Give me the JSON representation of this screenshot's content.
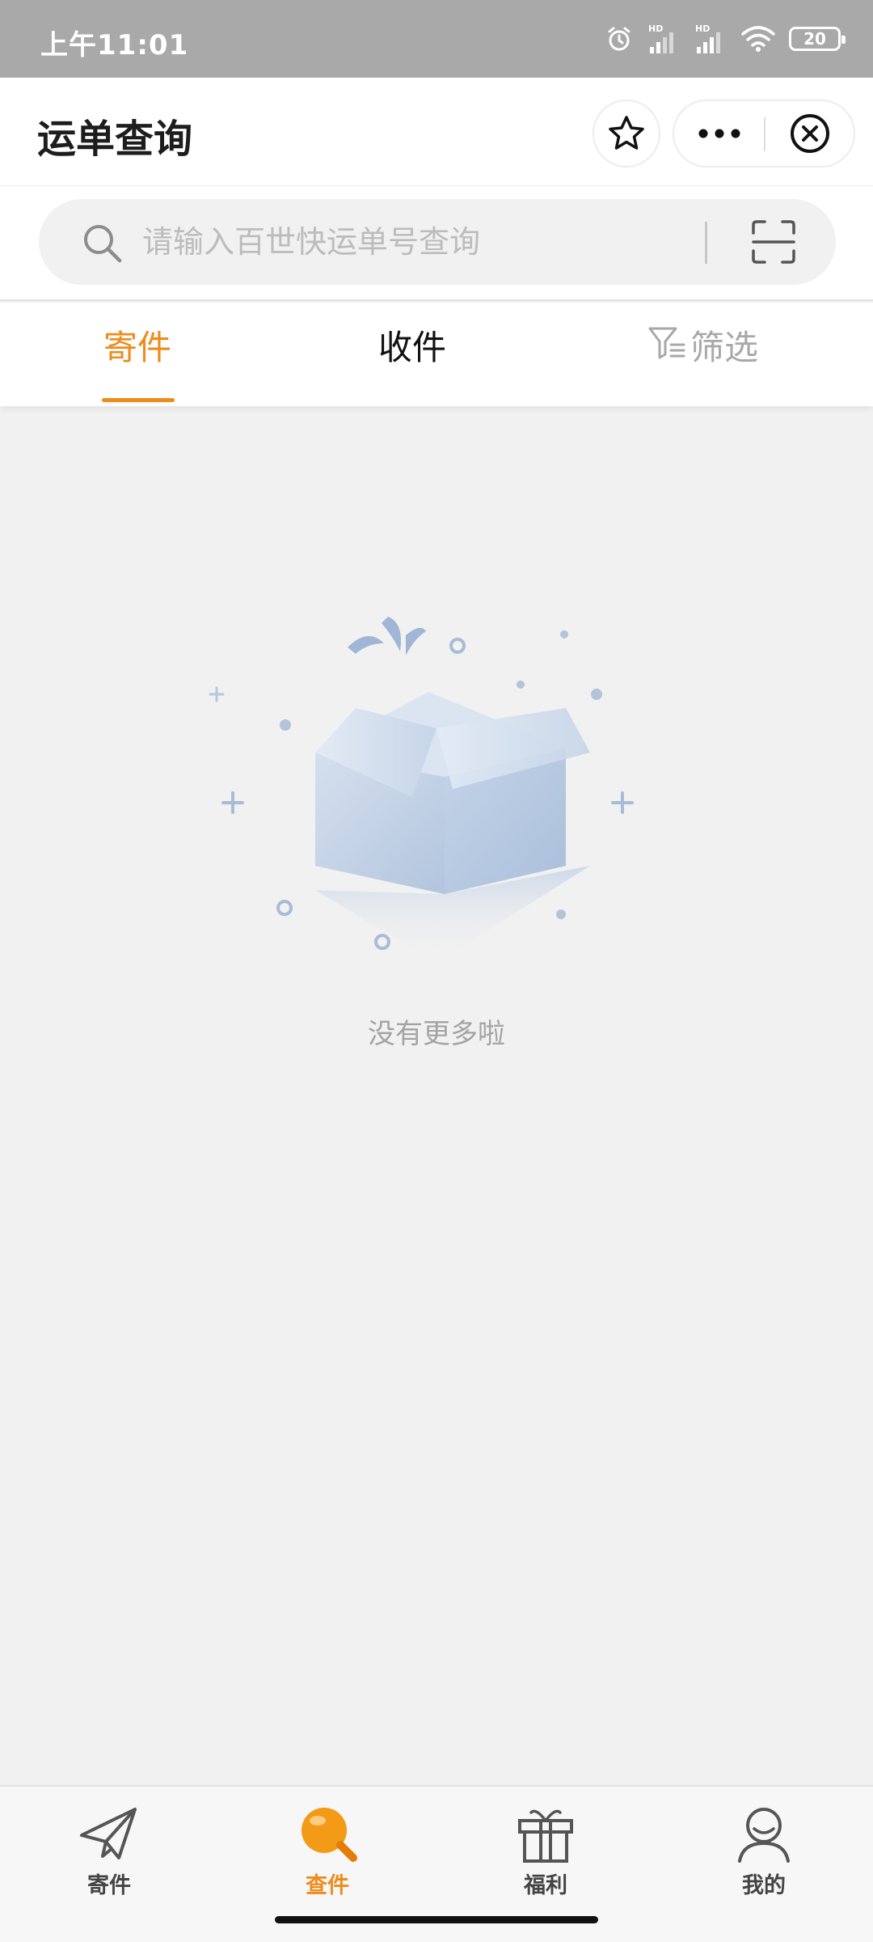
{
  "status_bar": {
    "time": "上午11:01",
    "signal1_label": "HD",
    "signal2_label": "HD",
    "battery": "20"
  },
  "header": {
    "title": "运单查询"
  },
  "search": {
    "placeholder": "请输入百世快运单号查询"
  },
  "tabs": [
    {
      "label": "寄件",
      "active": true
    },
    {
      "label": "收件",
      "active": false
    },
    {
      "label": "筛选",
      "active": false
    }
  ],
  "empty_state": {
    "message": "没有更多啦"
  },
  "bottom_nav": [
    {
      "label": "寄件",
      "icon": "paper-plane-icon",
      "active": false
    },
    {
      "label": "查件",
      "icon": "magnifier-icon",
      "active": true
    },
    {
      "label": "福利",
      "icon": "gift-icon",
      "active": false
    },
    {
      "label": "我的",
      "icon": "user-icon",
      "active": false
    }
  ],
  "colors": {
    "accent": "#ee8b1a",
    "status_bar": "#a9a9a9",
    "background": "#f1f1f1"
  }
}
